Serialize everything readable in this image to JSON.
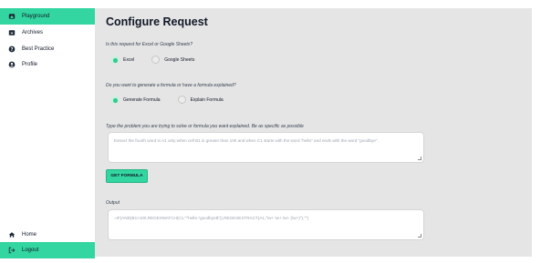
{
  "sidebar": {
    "items": [
      {
        "label": "Playground",
        "icon": "home-icon",
        "active": true
      },
      {
        "label": "Archives",
        "icon": "archive-icon",
        "active": false
      },
      {
        "label": "Best Practice",
        "icon": "help-circle-icon",
        "active": false
      },
      {
        "label": "Profile",
        "icon": "user-circle-icon",
        "active": false
      }
    ],
    "bottom": [
      {
        "label": "Home",
        "icon": "house-icon"
      },
      {
        "label": "Logout",
        "icon": "logout-icon",
        "active": true
      }
    ]
  },
  "main": {
    "title": "Configure Request",
    "q1": {
      "question": "Is this request for Excel or Google Sheets?",
      "options": [
        {
          "label": "Excel",
          "checked": true
        },
        {
          "label": "Google Sheets",
          "checked": false
        }
      ]
    },
    "q2": {
      "question": "Do you want to generate a formula or have a formula explained?",
      "options": [
        {
          "label": "Generate Formula",
          "checked": true
        },
        {
          "label": "Explain Formula",
          "checked": false
        }
      ]
    },
    "problem": {
      "label": "Type the problem you are trying to solve or formula you want explained. Be as specific as possible",
      "placeholder": "Extract the fourth word in A1 only when cell B1 is greater than 100 and when C1 starts with the word \"hello\" and ends with the word \"goodbye\"."
    },
    "button_label": "GET FORMULA",
    "output": {
      "label": "Output",
      "placeholder": "=IF(AND(B1>100,REGEXMATCH(C1,\"^hello.*goodbye$\")),REGEXEXTRACT(A1,\"\\w+ \\w+ \\w+ (\\w+)\"),\"\")"
    },
    "colors": {
      "accent": "#33d6a0",
      "background": "#e5e5e5"
    }
  }
}
